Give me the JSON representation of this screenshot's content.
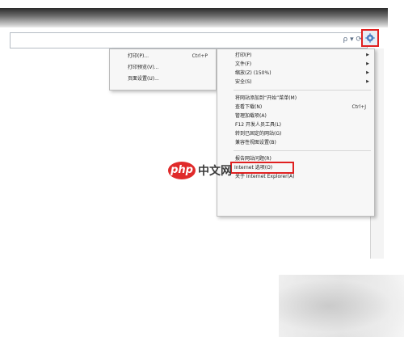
{
  "address_bar": {
    "controls": "ρ ▾ ⟳"
  },
  "gear_icon": "gear-icon",
  "submenu": {
    "items": [
      {
        "label": "打印(P)...",
        "shortcut": "Ctrl+P"
      },
      {
        "label": "打印预览(V)...",
        "shortcut": ""
      },
      {
        "label": "页面设置(U)...",
        "shortcut": ""
      }
    ]
  },
  "main_menu": {
    "group1": [
      {
        "label": "打印(P)",
        "arrow": "▶"
      },
      {
        "label": "文件(F)",
        "arrow": "▶"
      },
      {
        "label": "缩放(Z) (150%)",
        "arrow": "▶"
      },
      {
        "label": "安全(S)",
        "arrow": "▶"
      }
    ],
    "group2": [
      {
        "label": "将网站添加到“开始”菜单(M)",
        "shortcut": ""
      },
      {
        "label": "查看下载(N)",
        "shortcut": "Ctrl+J"
      },
      {
        "label": "管理加载项(A)",
        "shortcut": ""
      },
      {
        "label": "F12 开发人员工具(L)",
        "shortcut": ""
      },
      {
        "label": "转到已固定的网站(G)",
        "shortcut": ""
      },
      {
        "label": "兼容性视图设置(B)",
        "shortcut": ""
      }
    ],
    "group3": [
      {
        "label": "报告网站问题(R)"
      },
      {
        "label": "Internet 选项(O)"
      },
      {
        "label": "关于 Internet Explorer(A)"
      }
    ]
  },
  "watermark": {
    "badge": "php",
    "text": "中文网"
  },
  "colors": {
    "highlight": "#e02020",
    "logo": "#e02a2a"
  }
}
